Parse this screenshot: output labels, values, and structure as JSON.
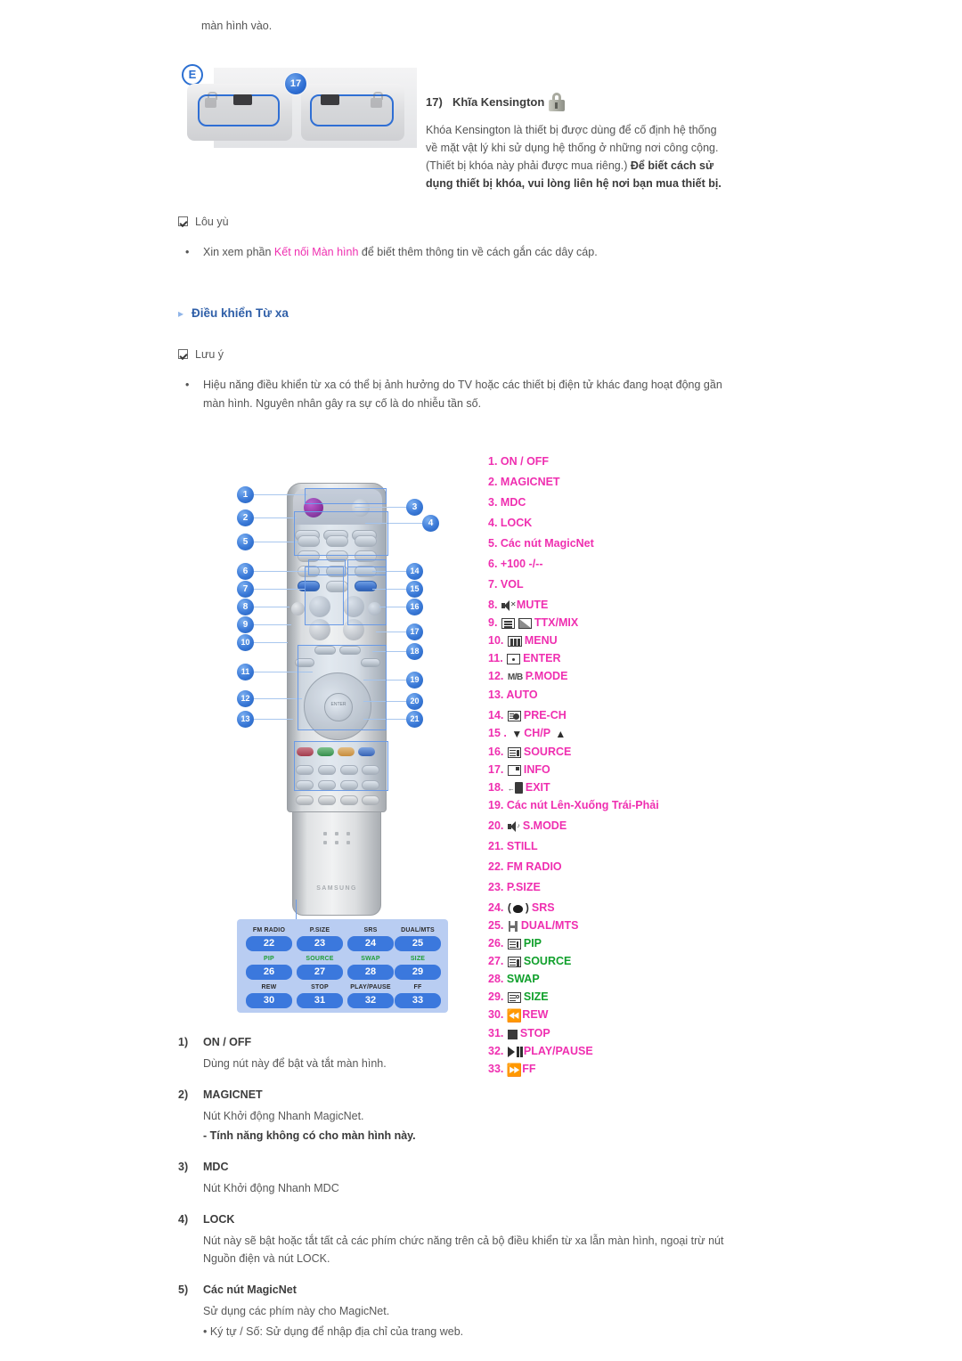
{
  "top_paragraph": "màn hình vào.",
  "kensington": {
    "figure_label": "E",
    "callout_number": "17",
    "heading_num": "17)",
    "heading_text": "Khĩa Kensington",
    "lock_icon": "padlock-icon",
    "paragraph_1": "Khóa Kensington là thiết bị được dùng để cố định hệ thống về mặt vật lý khi sử dụng hệ thống ở những nơi công cộng. (Thiết bị khóa này phải được mua riêng.)",
    "paragraph_2": "Để biết cách sử dụng thiết bị khóa, vui lòng liên hệ nơi bạn mua thiết bị."
  },
  "note_1": {
    "title": "Lôu yù",
    "bullet_pre": "Xin xem phần ",
    "bullet_link": "Kết nối Màn hình",
    "bullet_post": " để biết thêm thông tin về cách gắn các dây cáp."
  },
  "section_heading": "Điều khiển Từ xa",
  "note_2": {
    "title": "Lưu ý",
    "bullet": "Hiệu năng điều khiển từ xa có thể bị ảnh hưởng do TV hoặc các thiết bị điện tử khác đang hoạt động gần màn hình. Nguyên nhân gây ra sự cố là do nhiễu tần số."
  },
  "remote_figure": {
    "left_callouts": [
      "1",
      "2",
      "5",
      "6",
      "7",
      "8",
      "9",
      "10",
      "11",
      "12",
      "13"
    ],
    "right_callouts": [
      "3",
      "4",
      "14",
      "15",
      "16",
      "17",
      "18",
      "19",
      "20",
      "21"
    ],
    "brand": "SAMSUNG",
    "enter_label": "ENTER",
    "legend_grid": [
      {
        "label": "FM RADIO",
        "num": "22",
        "green": false
      },
      {
        "label": "P.SIZE",
        "num": "23",
        "green": false
      },
      {
        "label": "SRS",
        "num": "24",
        "green": false
      },
      {
        "label": "DUAL/MTS",
        "num": "25",
        "green": false
      },
      {
        "label": "PIP",
        "num": "26",
        "green": true
      },
      {
        "label": "SOURCE",
        "num": "27",
        "green": true
      },
      {
        "label": "SWAP",
        "num": "28",
        "green": true
      },
      {
        "label": "SIZE",
        "num": "29",
        "green": true
      },
      {
        "label": "REW",
        "num": "30",
        "green": false
      },
      {
        "label": "STOP",
        "num": "31",
        "green": false
      },
      {
        "label": "PLAY/PAUSE",
        "num": "32",
        "green": false
      },
      {
        "label": "FF",
        "num": "33",
        "green": false
      }
    ]
  },
  "remote_list": [
    {
      "num": "1.",
      "label": "ON / OFF",
      "icon": null,
      "green": false,
      "spaced": true
    },
    {
      "num": "2.",
      "label": "MAGICNET",
      "icon": null,
      "green": false,
      "spaced": true
    },
    {
      "num": "3.",
      "label": "MDC",
      "icon": null,
      "green": false,
      "spaced": true
    },
    {
      "num": "4.",
      "label": "LOCK",
      "icon": null,
      "green": false,
      "spaced": true
    },
    {
      "num": "5.",
      "label": "Các nút MagicNet",
      "icon": null,
      "green": false,
      "spaced": true
    },
    {
      "num": "6.",
      "label": "+100 -/--",
      "icon": null,
      "green": false,
      "spaced": true
    },
    {
      "num": "7.",
      "label": "VOL",
      "icon": null,
      "green": false,
      "spaced": true
    },
    {
      "num": "8.",
      "label": "MUTE",
      "icon": "mute-icon",
      "green": false,
      "spaced": false
    },
    {
      "num": "9.",
      "label": "TTX/MIX",
      "icon": "teletext-icon",
      "green": false,
      "spaced": false
    },
    {
      "num": "10.",
      "label": "MENU",
      "icon": "menu-icon",
      "green": false,
      "spaced": false
    },
    {
      "num": "11.",
      "label": "ENTER",
      "icon": "enter-icon",
      "green": false,
      "spaced": false
    },
    {
      "num": "12.",
      "label": "P.MODE",
      "icon": "mb-icon",
      "green": false,
      "spaced": false
    },
    {
      "num": "13.",
      "label": "AUTO",
      "icon": null,
      "green": false,
      "spaced": true
    },
    {
      "num": "14.",
      "label": "PRE-CH",
      "icon": "prech-icon",
      "green": false,
      "spaced": false
    },
    {
      "num": "15 .",
      "label": "CH/P",
      "icon": "chevron-updown-icon",
      "green": false,
      "spaced": false
    },
    {
      "num": "16.",
      "label": "SOURCE",
      "icon": "source-icon",
      "green": false,
      "spaced": false
    },
    {
      "num": "17.",
      "label": "INFO",
      "icon": "info-icon",
      "green": false,
      "spaced": false
    },
    {
      "num": "18.",
      "label": "EXIT",
      "icon": "exit-icon",
      "green": false,
      "spaced": false
    },
    {
      "num": "19.",
      "label": "Các nút Lên-Xuống Trái-Phải",
      "icon": null,
      "green": false,
      "spaced": true
    },
    {
      "num": "20.",
      "label": "S.MODE",
      "icon": "smode-icon",
      "green": false,
      "spaced": true
    },
    {
      "num": "21.",
      "label": "STILL",
      "icon": null,
      "green": false,
      "spaced": true
    },
    {
      "num": "22.",
      "label": "FM RADIO",
      "icon": null,
      "green": false,
      "spaced": true
    },
    {
      "num": "23.",
      "label": "P.SIZE",
      "icon": null,
      "green": false,
      "spaced": true
    },
    {
      "num": "24.",
      "label": "SRS",
      "icon": "srs-icon",
      "green": false,
      "spaced": false
    },
    {
      "num": "25.",
      "label": "DUAL/MTS",
      "icon": "dual-icon",
      "green": false,
      "spaced": false
    },
    {
      "num": "26.",
      "label": "PIP",
      "icon": "pip-icon",
      "green": true,
      "spaced": false
    },
    {
      "num": "27.",
      "label": "SOURCE",
      "icon": "source2-icon",
      "green": true,
      "spaced": false
    },
    {
      "num": "28.",
      "label": "SWAP",
      "icon": null,
      "green": true,
      "spaced": false
    },
    {
      "num": "29.",
      "label": "SIZE",
      "icon": "size-icon",
      "green": true,
      "spaced": false
    },
    {
      "num": "30.",
      "label": "REW",
      "icon": "rewind-icon",
      "green": false,
      "spaced": false
    },
    {
      "num": "31.",
      "label": "STOP",
      "icon": "stop-icon",
      "green": false,
      "spaced": false
    },
    {
      "num": "32.",
      "label": "PLAY/PAUSE",
      "icon": "playpause-icon",
      "green": false,
      "spaced": false
    },
    {
      "num": "33.",
      "label": "FF",
      "icon": "fastforward-icon",
      "green": false,
      "spaced": false
    }
  ],
  "descriptions": [
    {
      "n": "1)",
      "title": "ON / OFF",
      "body": "Dùng nút này để bật và tắt màn hình.",
      "bold_note": null,
      "sub": null
    },
    {
      "n": "2)",
      "title": "MAGICNET",
      "body": "Nút Khởi động Nhanh MagicNet.",
      "bold_note": "- Tính năng không có cho màn hình này.",
      "sub": null
    },
    {
      "n": "3)",
      "title": "MDC",
      "body": "Nút Khởi động Nhanh MDC",
      "bold_note": null,
      "sub": null
    },
    {
      "n": "4)",
      "title": "LOCK",
      "body": "Nút này sẽ bật hoặc tắt tất cả các phím chức năng trên cả bộ điều khiển từ xa lẫn màn hình, ngoại trừ nút Nguồn điện và nút LOCK.",
      "bold_note": null,
      "sub": null
    },
    {
      "n": "5)",
      "title": "Các nút MagicNet",
      "body": "Sử dụng các phím này cho MagicNet.",
      "bold_note": null,
      "sub": "• Ký tự / Số: Sử dụng để nhập địa chỉ của trang web."
    }
  ],
  "colors": {
    "magenta": "#ef2fb0",
    "green": "#11a02c",
    "heading_blue": "#2f5fa8",
    "callout_blue": "#3b7ad8"
  }
}
